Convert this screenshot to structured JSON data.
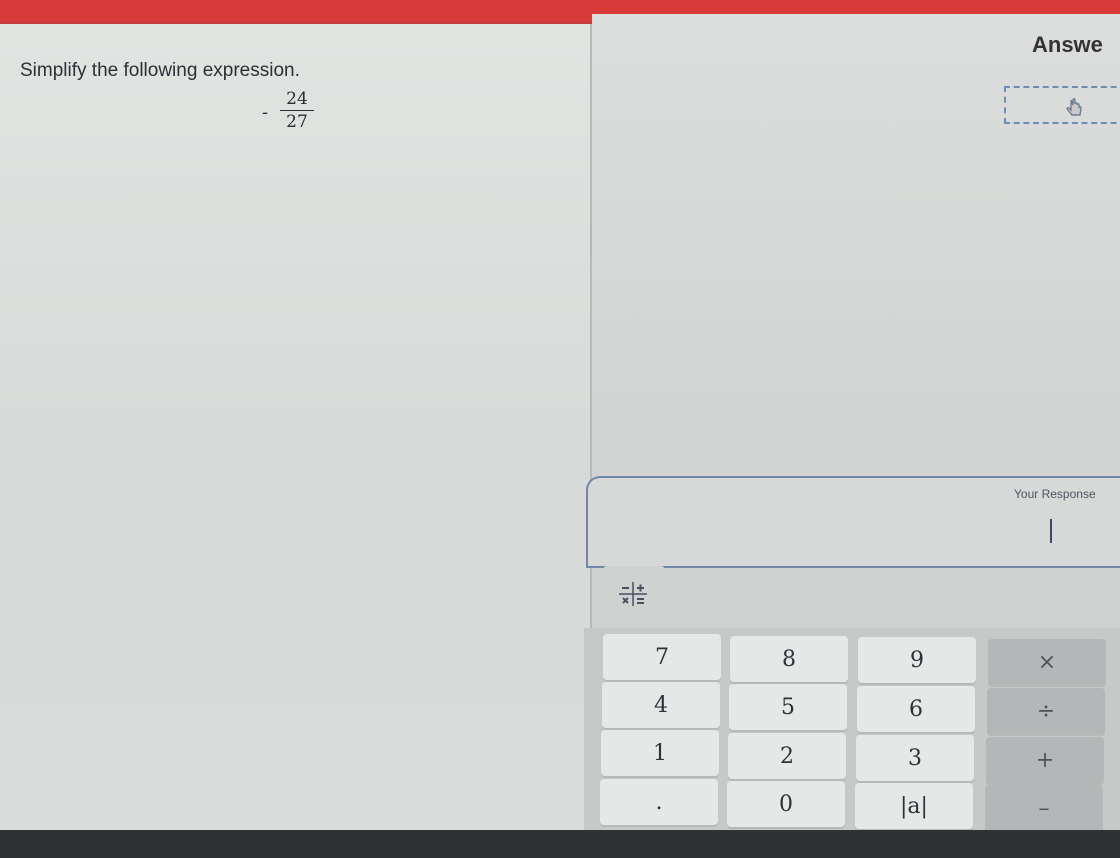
{
  "question": {
    "prompt": "Simplify the following expression.",
    "expression": {
      "sign": "-",
      "numerator": "24",
      "denominator": "27"
    }
  },
  "answer": {
    "title": "Answe",
    "icons": {
      "pointer": "hand-pointer-icon"
    }
  },
  "response": {
    "label": "Your Response"
  },
  "keypad": {
    "tab_icon": "operators-icon",
    "keys": {
      "k7": "7",
      "k8": "8",
      "k9": "9",
      "times": "×",
      "k4": "4",
      "k5": "5",
      "k6": "6",
      "divide": "÷",
      "k1": "1",
      "k2": "2",
      "k3": "3",
      "plus": "+",
      "dot": ".",
      "k0": "0",
      "abs": "|a|",
      "minus": "–"
    }
  },
  "colors": {
    "header": "#d83a3a",
    "dashed_border": "#6d8db4",
    "response_border": "#7287a7",
    "operator_key": "#b4b7b8"
  }
}
